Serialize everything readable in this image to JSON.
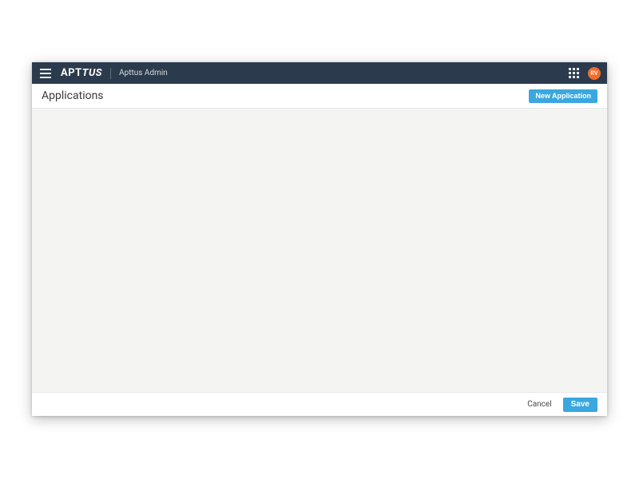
{
  "header": {
    "brand_prefix": "APT",
    "brand_suffix": "TUS",
    "context_label": "Apttus Admin",
    "avatar_initials": "RV"
  },
  "page": {
    "title": "Applications",
    "new_button_label": "New Application"
  },
  "footer": {
    "cancel_label": "Cancel",
    "save_label": "Save"
  },
  "colors": {
    "topbar_bg": "#2b3b4d",
    "primary": "#3aa7de",
    "avatar_bg": "#f36b2a",
    "canvas_bg": "#f4f4f3"
  }
}
